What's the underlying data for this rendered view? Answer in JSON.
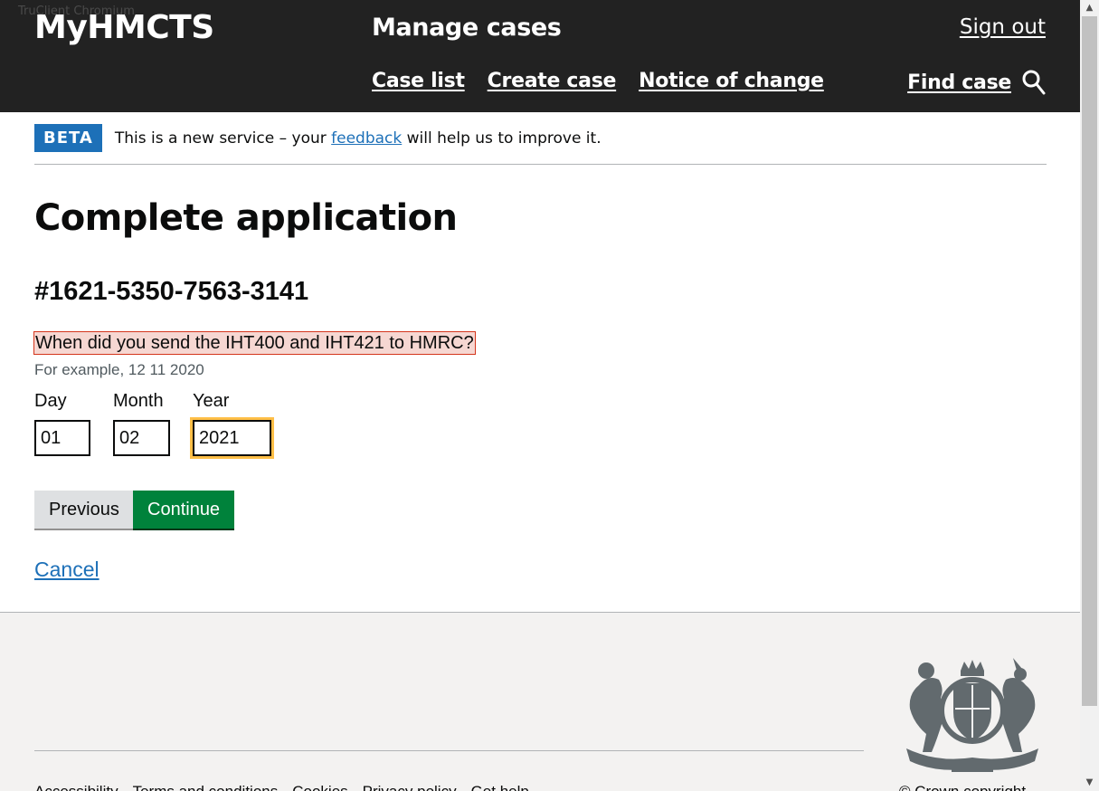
{
  "window": {
    "title": "TruClient Chromium"
  },
  "header": {
    "logo": "MyHMCTS",
    "service_name": "Manage cases",
    "sign_out": "Sign out",
    "nav": [
      {
        "label": "Case list"
      },
      {
        "label": "Create case"
      },
      {
        "label": "Notice of change"
      }
    ],
    "find_case": "Find case",
    "search_icon": "search-icon"
  },
  "phase_banner": {
    "tag": "BETA",
    "text_before": "This is a new service – your ",
    "link": "feedback",
    "text_after": " will help us to improve it."
  },
  "page": {
    "title": "Complete application",
    "case_reference": "#1621-5350-7563-3141",
    "question": "When did you send the IHT400 and IHT421 to HMRC?",
    "hint": "For example, 12 11 2020",
    "date": {
      "day_label": "Day",
      "day_value": "01",
      "month_label": "Month",
      "month_value": "02",
      "year_label": "Year",
      "year_value": "2021"
    },
    "previous_button": "Previous",
    "continue_button": "Continue",
    "cancel_link": "Cancel"
  },
  "footer": {
    "crest_icon": "royal-coat-of-arms-icon",
    "links": [
      "Accessibility",
      "Terms and conditions",
      "Cookies",
      "Privacy policy",
      "Get help"
    ],
    "copyright": "© Crown copyright"
  },
  "colors": {
    "header_bg": "#222222",
    "beta_tag": "#1d70b8",
    "link": "#1d70b8",
    "primary_button": "#00823b",
    "secondary_button": "#dee0e2",
    "error_highlight_bg": "#f6d7d2",
    "error_highlight_border": "#d4351c",
    "focus": "#ffbf47",
    "footer_bg": "#f3f2f1"
  }
}
